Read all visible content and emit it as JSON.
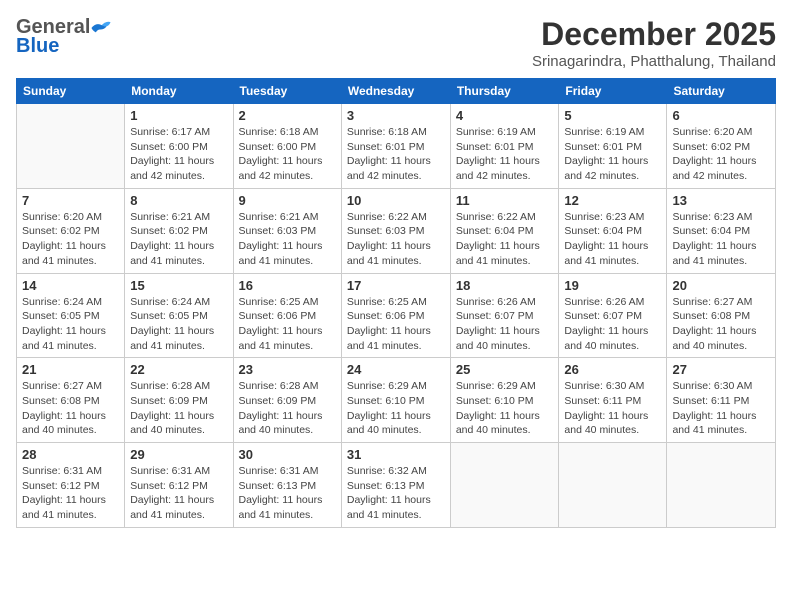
{
  "header": {
    "logo_general": "General",
    "logo_blue": "Blue",
    "title": "December 2025",
    "location": "Srinagarindra, Phatthalung, Thailand"
  },
  "days_of_week": [
    "Sunday",
    "Monday",
    "Tuesday",
    "Wednesday",
    "Thursday",
    "Friday",
    "Saturday"
  ],
  "weeks": [
    [
      {
        "day": "",
        "empty": true
      },
      {
        "day": "1",
        "sunrise": "Sunrise: 6:17 AM",
        "sunset": "Sunset: 6:00 PM",
        "daylight": "Daylight: 11 hours and 42 minutes."
      },
      {
        "day": "2",
        "sunrise": "Sunrise: 6:18 AM",
        "sunset": "Sunset: 6:00 PM",
        "daylight": "Daylight: 11 hours and 42 minutes."
      },
      {
        "day": "3",
        "sunrise": "Sunrise: 6:18 AM",
        "sunset": "Sunset: 6:01 PM",
        "daylight": "Daylight: 11 hours and 42 minutes."
      },
      {
        "day": "4",
        "sunrise": "Sunrise: 6:19 AM",
        "sunset": "Sunset: 6:01 PM",
        "daylight": "Daylight: 11 hours and 42 minutes."
      },
      {
        "day": "5",
        "sunrise": "Sunrise: 6:19 AM",
        "sunset": "Sunset: 6:01 PM",
        "daylight": "Daylight: 11 hours and 42 minutes."
      },
      {
        "day": "6",
        "sunrise": "Sunrise: 6:20 AM",
        "sunset": "Sunset: 6:02 PM",
        "daylight": "Daylight: 11 hours and 42 minutes."
      }
    ],
    [
      {
        "day": "7",
        "sunrise": "Sunrise: 6:20 AM",
        "sunset": "Sunset: 6:02 PM",
        "daylight": "Daylight: 11 hours and 41 minutes."
      },
      {
        "day": "8",
        "sunrise": "Sunrise: 6:21 AM",
        "sunset": "Sunset: 6:02 PM",
        "daylight": "Daylight: 11 hours and 41 minutes."
      },
      {
        "day": "9",
        "sunrise": "Sunrise: 6:21 AM",
        "sunset": "Sunset: 6:03 PM",
        "daylight": "Daylight: 11 hours and 41 minutes."
      },
      {
        "day": "10",
        "sunrise": "Sunrise: 6:22 AM",
        "sunset": "Sunset: 6:03 PM",
        "daylight": "Daylight: 11 hours and 41 minutes."
      },
      {
        "day": "11",
        "sunrise": "Sunrise: 6:22 AM",
        "sunset": "Sunset: 6:04 PM",
        "daylight": "Daylight: 11 hours and 41 minutes."
      },
      {
        "day": "12",
        "sunrise": "Sunrise: 6:23 AM",
        "sunset": "Sunset: 6:04 PM",
        "daylight": "Daylight: 11 hours and 41 minutes."
      },
      {
        "day": "13",
        "sunrise": "Sunrise: 6:23 AM",
        "sunset": "Sunset: 6:04 PM",
        "daylight": "Daylight: 11 hours and 41 minutes."
      }
    ],
    [
      {
        "day": "14",
        "sunrise": "Sunrise: 6:24 AM",
        "sunset": "Sunset: 6:05 PM",
        "daylight": "Daylight: 11 hours and 41 minutes."
      },
      {
        "day": "15",
        "sunrise": "Sunrise: 6:24 AM",
        "sunset": "Sunset: 6:05 PM",
        "daylight": "Daylight: 11 hours and 41 minutes."
      },
      {
        "day": "16",
        "sunrise": "Sunrise: 6:25 AM",
        "sunset": "Sunset: 6:06 PM",
        "daylight": "Daylight: 11 hours and 41 minutes."
      },
      {
        "day": "17",
        "sunrise": "Sunrise: 6:25 AM",
        "sunset": "Sunset: 6:06 PM",
        "daylight": "Daylight: 11 hours and 41 minutes."
      },
      {
        "day": "18",
        "sunrise": "Sunrise: 6:26 AM",
        "sunset": "Sunset: 6:07 PM",
        "daylight": "Daylight: 11 hours and 40 minutes."
      },
      {
        "day": "19",
        "sunrise": "Sunrise: 6:26 AM",
        "sunset": "Sunset: 6:07 PM",
        "daylight": "Daylight: 11 hours and 40 minutes."
      },
      {
        "day": "20",
        "sunrise": "Sunrise: 6:27 AM",
        "sunset": "Sunset: 6:08 PM",
        "daylight": "Daylight: 11 hours and 40 minutes."
      }
    ],
    [
      {
        "day": "21",
        "sunrise": "Sunrise: 6:27 AM",
        "sunset": "Sunset: 6:08 PM",
        "daylight": "Daylight: 11 hours and 40 minutes."
      },
      {
        "day": "22",
        "sunrise": "Sunrise: 6:28 AM",
        "sunset": "Sunset: 6:09 PM",
        "daylight": "Daylight: 11 hours and 40 minutes."
      },
      {
        "day": "23",
        "sunrise": "Sunrise: 6:28 AM",
        "sunset": "Sunset: 6:09 PM",
        "daylight": "Daylight: 11 hours and 40 minutes."
      },
      {
        "day": "24",
        "sunrise": "Sunrise: 6:29 AM",
        "sunset": "Sunset: 6:10 PM",
        "daylight": "Daylight: 11 hours and 40 minutes."
      },
      {
        "day": "25",
        "sunrise": "Sunrise: 6:29 AM",
        "sunset": "Sunset: 6:10 PM",
        "daylight": "Daylight: 11 hours and 40 minutes."
      },
      {
        "day": "26",
        "sunrise": "Sunrise: 6:30 AM",
        "sunset": "Sunset: 6:11 PM",
        "daylight": "Daylight: 11 hours and 40 minutes."
      },
      {
        "day": "27",
        "sunrise": "Sunrise: 6:30 AM",
        "sunset": "Sunset: 6:11 PM",
        "daylight": "Daylight: 11 hours and 41 minutes."
      }
    ],
    [
      {
        "day": "28",
        "sunrise": "Sunrise: 6:31 AM",
        "sunset": "Sunset: 6:12 PM",
        "daylight": "Daylight: 11 hours and 41 minutes."
      },
      {
        "day": "29",
        "sunrise": "Sunrise: 6:31 AM",
        "sunset": "Sunset: 6:12 PM",
        "daylight": "Daylight: 11 hours and 41 minutes."
      },
      {
        "day": "30",
        "sunrise": "Sunrise: 6:31 AM",
        "sunset": "Sunset: 6:13 PM",
        "daylight": "Daylight: 11 hours and 41 minutes."
      },
      {
        "day": "31",
        "sunrise": "Sunrise: 6:32 AM",
        "sunset": "Sunset: 6:13 PM",
        "daylight": "Daylight: 11 hours and 41 minutes."
      },
      {
        "day": "",
        "empty": true
      },
      {
        "day": "",
        "empty": true
      },
      {
        "day": "",
        "empty": true
      }
    ]
  ]
}
